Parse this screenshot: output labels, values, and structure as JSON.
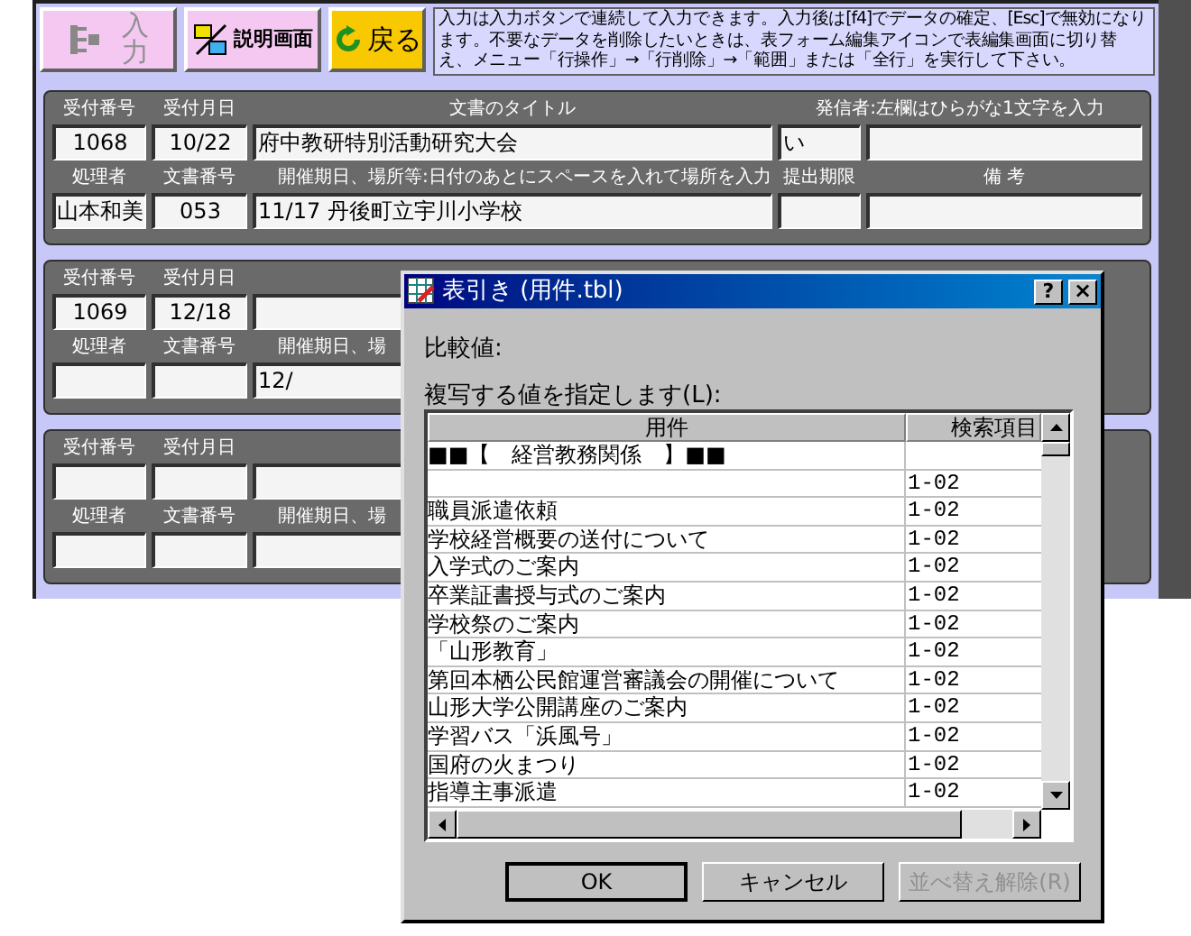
{
  "toolbar": {
    "buttons": [
      {
        "kind": "input",
        "label": "入力",
        "disabled": true
      },
      {
        "kind": "help",
        "label": "説明画面",
        "disabled": false
      },
      {
        "kind": "back",
        "label": "戻る",
        "disabled": false
      }
    ],
    "help_text": "入力は入力ボタンで連続して入力できます。入力後は[f4]でデータの確定、[Esc]で無効になります。不要なデータを削除したいときは、表フォーム編集アイコンで表編集画面に切り替え、メニュー「行操作」→「行削除」→「範囲」または「全行」を実行して下さい。"
  },
  "records": [
    {
      "top": [
        {
          "kind": "field",
          "label": "受付番号",
          "value": "1068"
        },
        {
          "kind": "field",
          "label": "受付月日",
          "value": "10/22"
        },
        {
          "kind": "field",
          "label": "文書のタイトル",
          "value": "府中教研特別活動研究大会"
        },
        {
          "kind": "split",
          "label": "発信者:左欄はひらがな1文字を入力",
          "value": "い"
        }
      ],
      "bottom": [
        {
          "kind": "field",
          "label": "処理者",
          "value": "山本和美"
        },
        {
          "kind": "field",
          "label": "文書番号",
          "value": "053"
        },
        {
          "kind": "field",
          "label": "開催期日、場所等:日付のあとにスペースを入れて場所を入力",
          "value": "11/17  丹後町立宇川小学校"
        },
        {
          "kind": "field",
          "label": "提出期限"
        },
        {
          "kind": "field",
          "label": "備 考"
        }
      ]
    },
    {
      "top": [
        {
          "kind": "field",
          "label": "受付番号",
          "value": "1069"
        },
        {
          "kind": "field",
          "label": "受付月日",
          "value": "12/18"
        },
        {
          "kind": "field"
        }
      ],
      "bottom": [
        {
          "kind": "field",
          "label": "処理者"
        },
        {
          "kind": "field",
          "label": "文書番号"
        },
        {
          "kind": "field",
          "label": "開催期日、場",
          "value": "12/"
        }
      ]
    },
    {
      "top": [
        {
          "kind": "field",
          "label": "受付番号"
        },
        {
          "kind": "field",
          "label": "受付月日"
        },
        {
          "kind": "field"
        }
      ],
      "bottom": [
        {
          "kind": "field",
          "label": "処理者"
        },
        {
          "kind": "field",
          "label": "文書番号"
        },
        {
          "kind": "field",
          "label": "開催期日、場"
        }
      ]
    }
  ],
  "dialog": {
    "title": "表引き (用件.tbl)",
    "help_button": "?",
    "close_button": "×",
    "compare_label": "比較値:",
    "list_label": "複写する値を指定します(L):",
    "columns": [
      "用件",
      "検索項目"
    ],
    "rows": [
      {
        "name": "■■【　経営教務関係　】■■"
      },
      {
        "code": "1-02"
      },
      {
        "name": "職員派遣依頼",
        "code": "1-02"
      },
      {
        "name": "学校経営概要の送付について",
        "code": "1-02"
      },
      {
        "name": "入学式のご案内",
        "code": "1-02"
      },
      {
        "name": "卒業証書授与式のご案内",
        "code": "1-02"
      },
      {
        "name": "学校祭のご案内",
        "code": "1-02"
      },
      {
        "name": "「山形教育」",
        "code": "1-02"
      },
      {
        "name": "第回本栖公民館運営審議会の開催について",
        "code": "1-02"
      },
      {
        "name": "山形大学公開講座のご案内",
        "code": "1-02"
      },
      {
        "name": "学習バス「浜風号」",
        "code": "1-02"
      },
      {
        "name": "国府の火まつり",
        "code": "1-02"
      },
      {
        "name": "指導主事派遣",
        "code": "1-02"
      }
    ],
    "buttons": [
      {
        "label": "OK",
        "disabled": false
      },
      {
        "label": "キャンセル",
        "disabled": false
      },
      {
        "label": "並べ替え解除(R)",
        "disabled": true
      }
    ]
  }
}
